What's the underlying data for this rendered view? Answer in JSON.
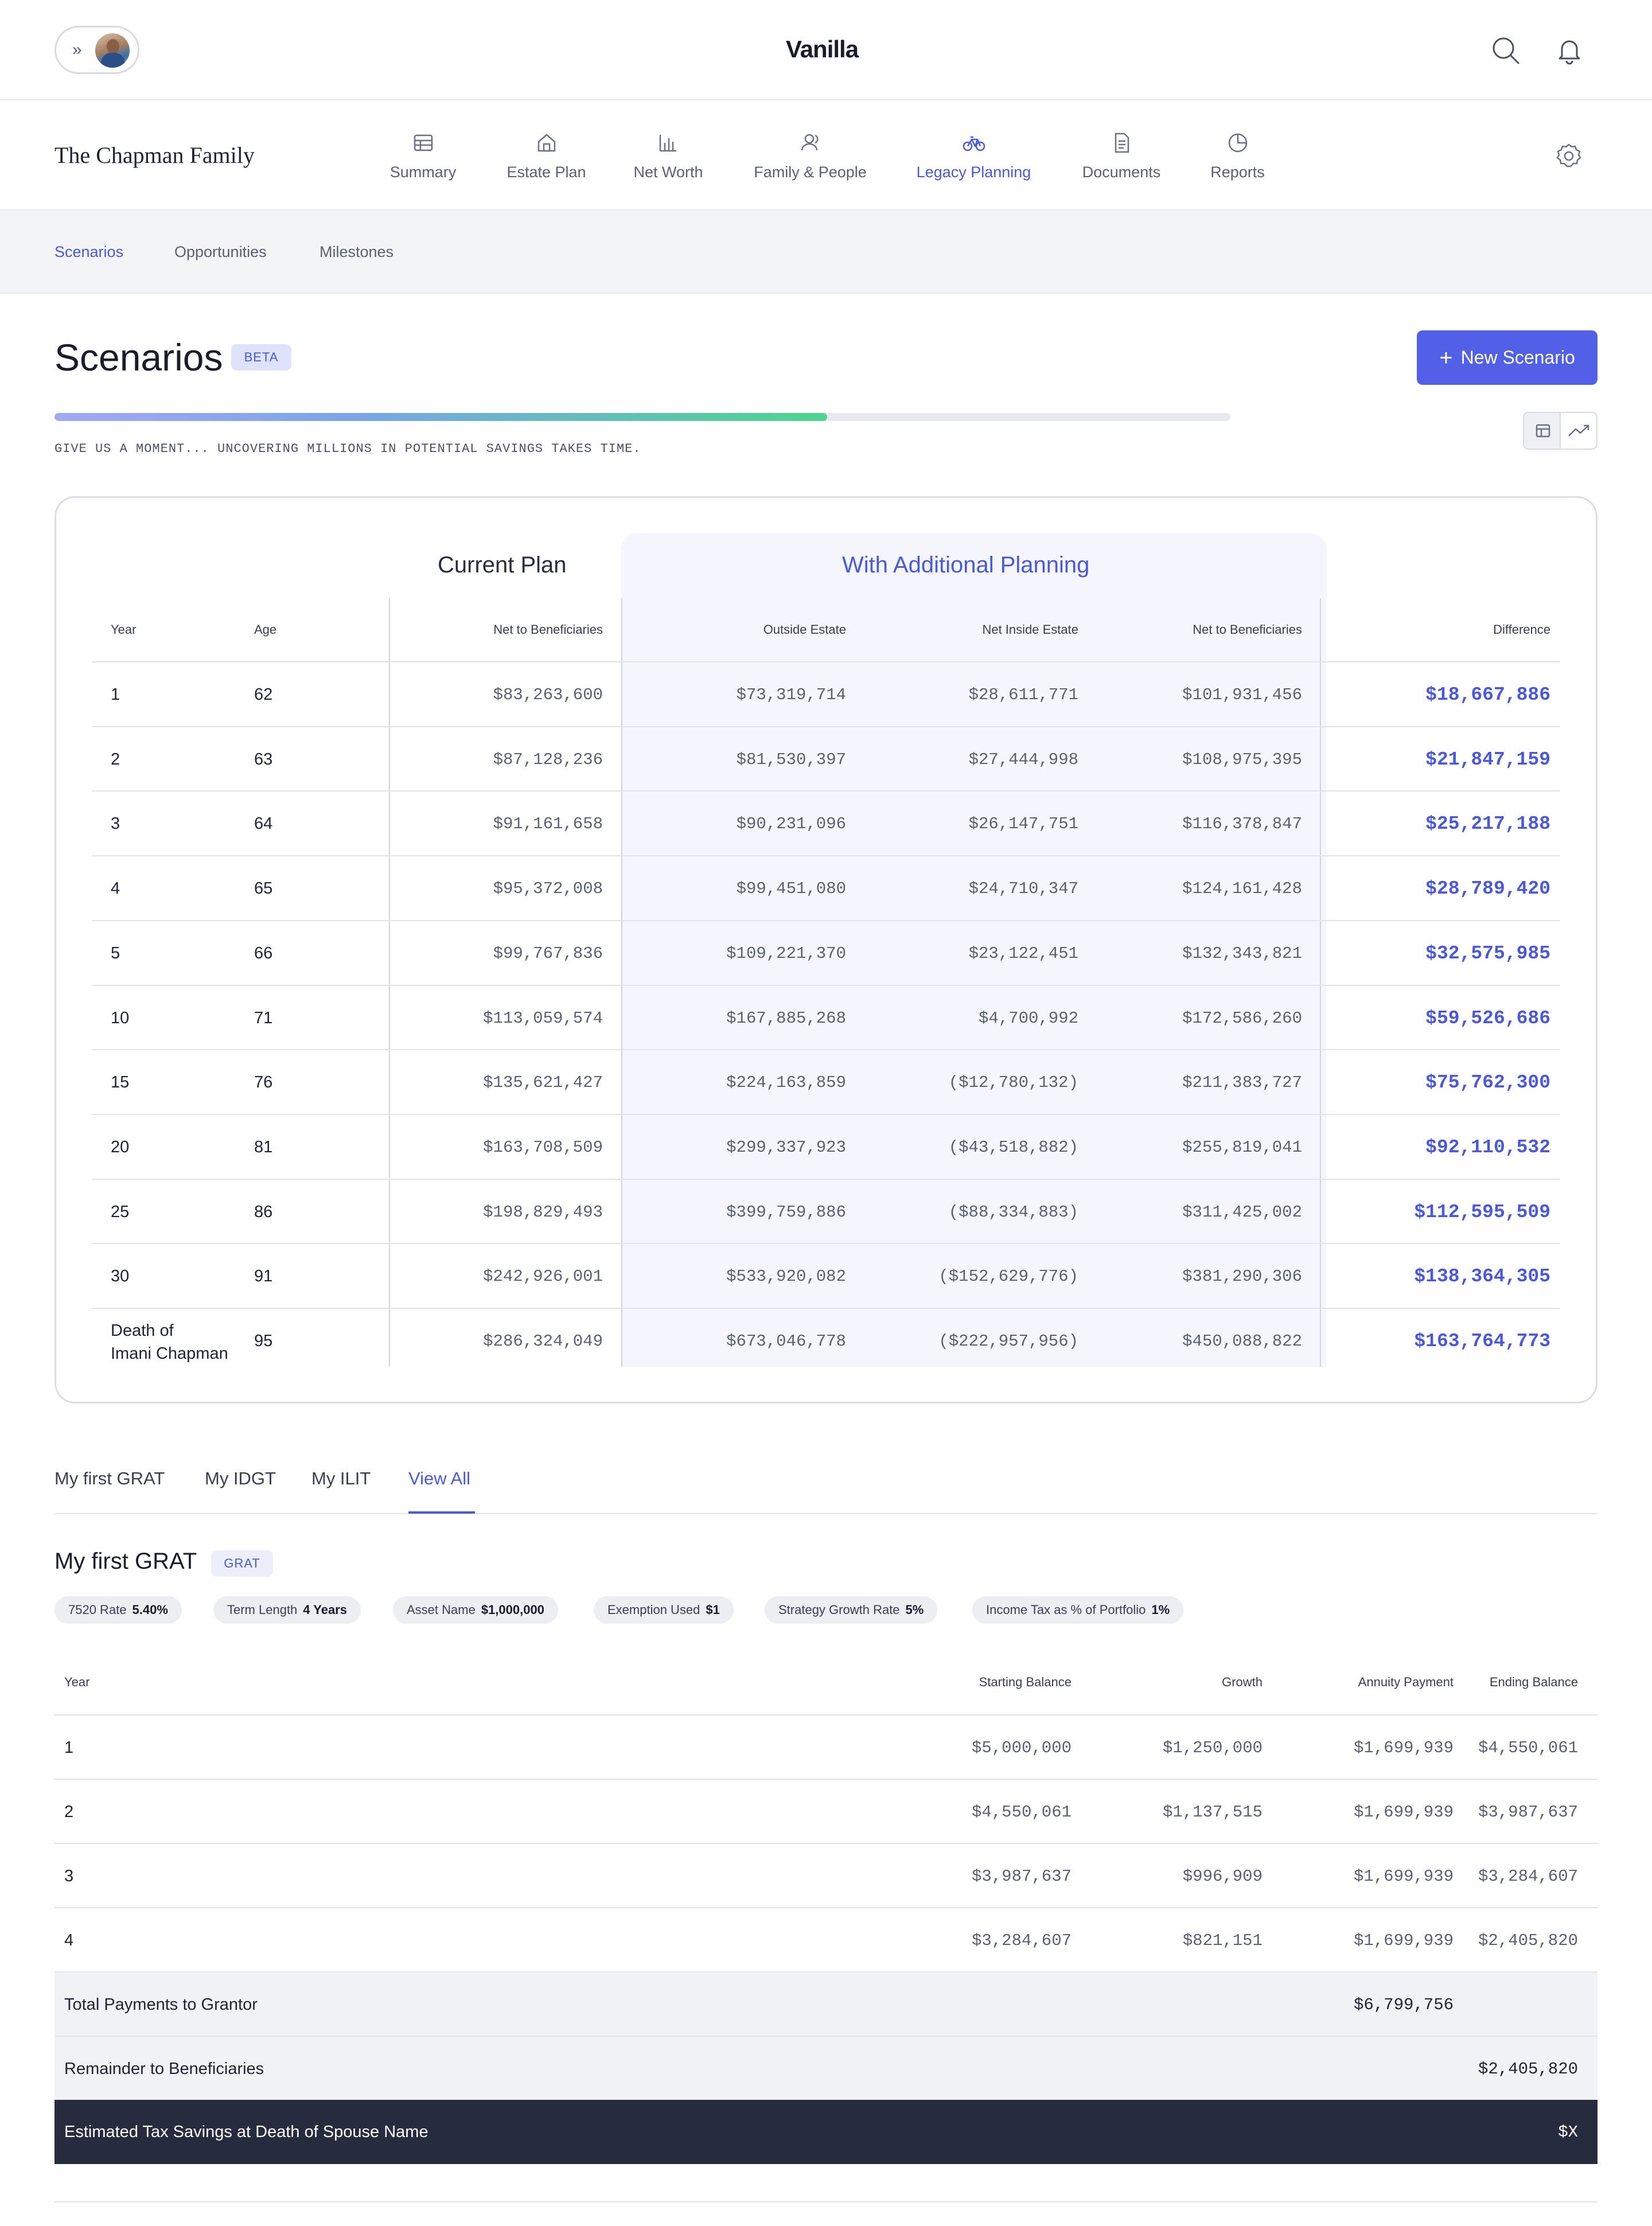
{
  "topbar": {
    "brand": "Vanilla",
    "collapse_glyph": "»",
    "icons": [
      "search-icon",
      "bell-icon"
    ]
  },
  "family": {
    "name": "The Chapman Family",
    "nav": [
      {
        "label": "Summary",
        "icon": "table-icon",
        "active": false
      },
      {
        "label": "Estate Plan",
        "icon": "house-icon",
        "active": false
      },
      {
        "label": "Net Worth",
        "icon": "bar-chart-icon",
        "active": false
      },
      {
        "label": "Family & People",
        "icon": "people-icon",
        "active": false
      },
      {
        "label": "Legacy Planning",
        "icon": "bicycle-icon",
        "active": true
      },
      {
        "label": "Documents",
        "icon": "document-icon",
        "active": false
      },
      {
        "label": "Reports",
        "icon": "pie-chart-icon",
        "active": false
      }
    ]
  },
  "subtabs": [
    {
      "label": "Scenarios",
      "active": true
    },
    {
      "label": "Opportunities",
      "active": false
    },
    {
      "label": "Milestones",
      "active": false
    }
  ],
  "page": {
    "title": "Scenarios",
    "badge": "BETA",
    "new_button": "New Scenario",
    "progress_fraction": 0.657,
    "progress_text": "GIVE US A MOMENT... UNCOVERING MILLIONS IN POTENTIAL SAVINGS TAKES TIME."
  },
  "scenario_table": {
    "group_current": "Current Plan",
    "group_additional": "With Additional Planning",
    "headers": {
      "year": "Year",
      "age": "Age",
      "net_current": "Net to Beneficiaries",
      "outside": "Outside Estate",
      "inside": "Net Inside Estate",
      "net_additional": "Net to Beneficiaries",
      "difference": "Difference"
    },
    "rows": [
      {
        "year": "1",
        "age": "62",
        "net_current": "$83,263,600",
        "outside": "$73,319,714",
        "inside": "$28,611,771",
        "net_additional": "$101,931,456",
        "difference": "$18,667,886"
      },
      {
        "year": "2",
        "age": "63",
        "net_current": "$87,128,236",
        "outside": "$81,530,397",
        "inside": "$27,444,998",
        "net_additional": "$108,975,395",
        "difference": "$21,847,159"
      },
      {
        "year": "3",
        "age": "64",
        "net_current": "$91,161,658",
        "outside": "$90,231,096",
        "inside": "$26,147,751",
        "net_additional": "$116,378,847",
        "difference": "$25,217,188"
      },
      {
        "year": "4",
        "age": "65",
        "net_current": "$95,372,008",
        "outside": "$99,451,080",
        "inside": "$24,710,347",
        "net_additional": "$124,161,428",
        "difference": "$28,789,420"
      },
      {
        "year": "5",
        "age": "66",
        "net_current": "$99,767,836",
        "outside": "$109,221,370",
        "inside": "$23,122,451",
        "net_additional": "$132,343,821",
        "difference": "$32,575,985"
      },
      {
        "year": "10",
        "age": "71",
        "net_current": "$113,059,574",
        "outside": "$167,885,268",
        "inside": "$4,700,992",
        "net_additional": "$172,586,260",
        "difference": "$59,526,686"
      },
      {
        "year": "15",
        "age": "76",
        "net_current": "$135,621,427",
        "outside": "$224,163,859",
        "inside": "($12,780,132)",
        "net_additional": "$211,383,727",
        "difference": "$75,762,300"
      },
      {
        "year": "20",
        "age": "81",
        "net_current": "$163,708,509",
        "outside": "$299,337,923",
        "inside": "($43,518,882)",
        "net_additional": "$255,819,041",
        "difference": "$92,110,532"
      },
      {
        "year": "25",
        "age": "86",
        "net_current": "$198,829,493",
        "outside": "$399,759,886",
        "inside": "($88,334,883)",
        "net_additional": "$311,425,002",
        "difference": "$112,595,509"
      },
      {
        "year": "30",
        "age": "91",
        "net_current": "$242,926,001",
        "outside": "$533,920,082",
        "inside": "($152,629,776)",
        "net_additional": "$381,290,306",
        "difference": "$138,364,305"
      },
      {
        "year_line1": "Death of",
        "year_line2": "Imani Chapman",
        "age": "95",
        "net_current": "$286,324,049",
        "outside": "$673,046,778",
        "inside": "($222,957,956)",
        "net_additional": "$450,088,822",
        "difference": "$163,764,773"
      }
    ]
  },
  "strategy_tabs": [
    {
      "label": "My first GRAT",
      "active": false
    },
    {
      "label": "My IDGT",
      "active": false
    },
    {
      "label": "My ILIT",
      "active": false
    },
    {
      "label": "View All",
      "active": true
    }
  ],
  "grat": {
    "title": "My first GRAT",
    "badge": "GRAT",
    "chips": [
      {
        "label": "7520 Rate",
        "value": "5.40%"
      },
      {
        "label": "Term Length",
        "value": "4 Years"
      },
      {
        "label": "Asset Name",
        "value": "$1,000,000"
      },
      {
        "label": "Exemption Used",
        "value": "$1"
      },
      {
        "label": "Strategy Growth Rate",
        "value": "5%"
      },
      {
        "label": "Income Tax as % of Portfolio",
        "value": "1%"
      }
    ],
    "headers": {
      "year": "Year",
      "starting": "Starting Balance",
      "growth": "Growth",
      "annuity": "Annuity Payment",
      "ending": "Ending Balance"
    },
    "rows": [
      {
        "year": "1",
        "starting": "$5,000,000",
        "growth": "$1,250,000",
        "annuity": "$1,699,939",
        "ending": "$4,550,061"
      },
      {
        "year": "2",
        "starting": "$4,550,061",
        "growth": "$1,137,515",
        "annuity": "$1,699,939",
        "ending": "$3,987,637"
      },
      {
        "year": "3",
        "starting": "$3,987,637",
        "growth": "$996,909",
        "annuity": "$1,699,939",
        "ending": "$3,284,607"
      },
      {
        "year": "4",
        "starting": "$3,284,607",
        "growth": "$821,151",
        "annuity": "$1,699,939",
        "ending": "$2,405,820"
      }
    ],
    "total_payments_label": "Total Payments to Grantor",
    "total_payments_value": "$6,799,756",
    "remainder_label": "Remainder to Beneficiaries",
    "remainder_value": "$2,405,820",
    "tax_savings_label": "Estimated Tax Savings at Death of Spouse Name",
    "tax_savings_value": "$X"
  }
}
